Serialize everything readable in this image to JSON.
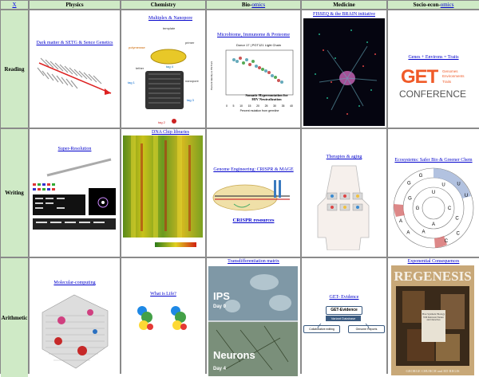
{
  "headers": {
    "corner": "X",
    "physics": "Physics",
    "chemistry": "Chemistry",
    "bio_prefix": "Bio-",
    "bio_suffix": "omics",
    "medicine": "Medicine",
    "socio_prefix": "Socio-econ-",
    "socio_suffix": "omics"
  },
  "rows": {
    "reading": "Reading",
    "writing": "Writing",
    "arithmetic": "Arithmetic"
  },
  "reading": {
    "physics": "Dark matter & SETG & Sence Genetics",
    "chemistry": "Multiplex & Nanopore",
    "chem_labels": [
      "template",
      "primer",
      "polymerase",
      "tag 4",
      "tether",
      "tag 1",
      "nanopore",
      "tag 3",
      "tag 2"
    ],
    "bio": "Microbiome, Immunome & Proteome",
    "bio_plot_title": "Donor 17 | PGT121 Light Chain",
    "bio_plot_ylabel": "Percent Identity to PGT121",
    "bio_plot_xlabel": "Percent mutation from germline",
    "bio_plot_caption1": "Somatic Hypermutation for",
    "bio_plot_caption2": "HIV Neutralization",
    "bio_x_ticks": [
      "0",
      "5",
      "10",
      "15",
      "20",
      "25",
      "30",
      "35",
      "40"
    ],
    "medicine": "FISSEQ & the BRAIN initiative",
    "socio": "Genes + Environs = Traits",
    "get_logo": "GET",
    "get_side": [
      "Genomes",
      "Environments",
      "Traits"
    ],
    "conference": "CONFERENCE"
  },
  "writing": {
    "physics": "Super-Resolution",
    "chemistry": "DNA Chip libraries",
    "bio": "Genome Engineering: CRISPR & MAGE",
    "crispr_resources": "CRISPR resources",
    "medicine": "Therapies & aging",
    "socio": "Ecosystems: Safer Bio & Greener Chem",
    "codon_letters": [
      "U",
      "C",
      "A",
      "G",
      "U",
      "C",
      "A",
      "G",
      "U",
      "C",
      "A",
      "G",
      "U",
      "C",
      "A",
      "G"
    ]
  },
  "arithmetic": {
    "physics": "Molecular-computing",
    "chemistry": "What is Life?",
    "bio": "Transdifferentiation matrix",
    "ips": "IPS",
    "day0": "Day 0",
    "neurons": "Neurons",
    "day4": "Day 4",
    "medicine": "GET- Evidence",
    "get_evidence_box": "GET-Evidence",
    "variant_db": "Variant Database",
    "collab": "Collaborative editing",
    "genome_reports": "Genome Reports",
    "socio": "Exponential Consequences",
    "book_title": "REGENESIS",
    "book_sub": "How Synthetic Biology Will Reinvent Nature and Ourselves",
    "book_authors": "GEORGE CHURCH and ED REGIS"
  },
  "colors": {
    "header_bg": "#cfeac6",
    "link": "#0000cc",
    "border": "#8a8a8a",
    "get_orange": "#f05a28"
  }
}
